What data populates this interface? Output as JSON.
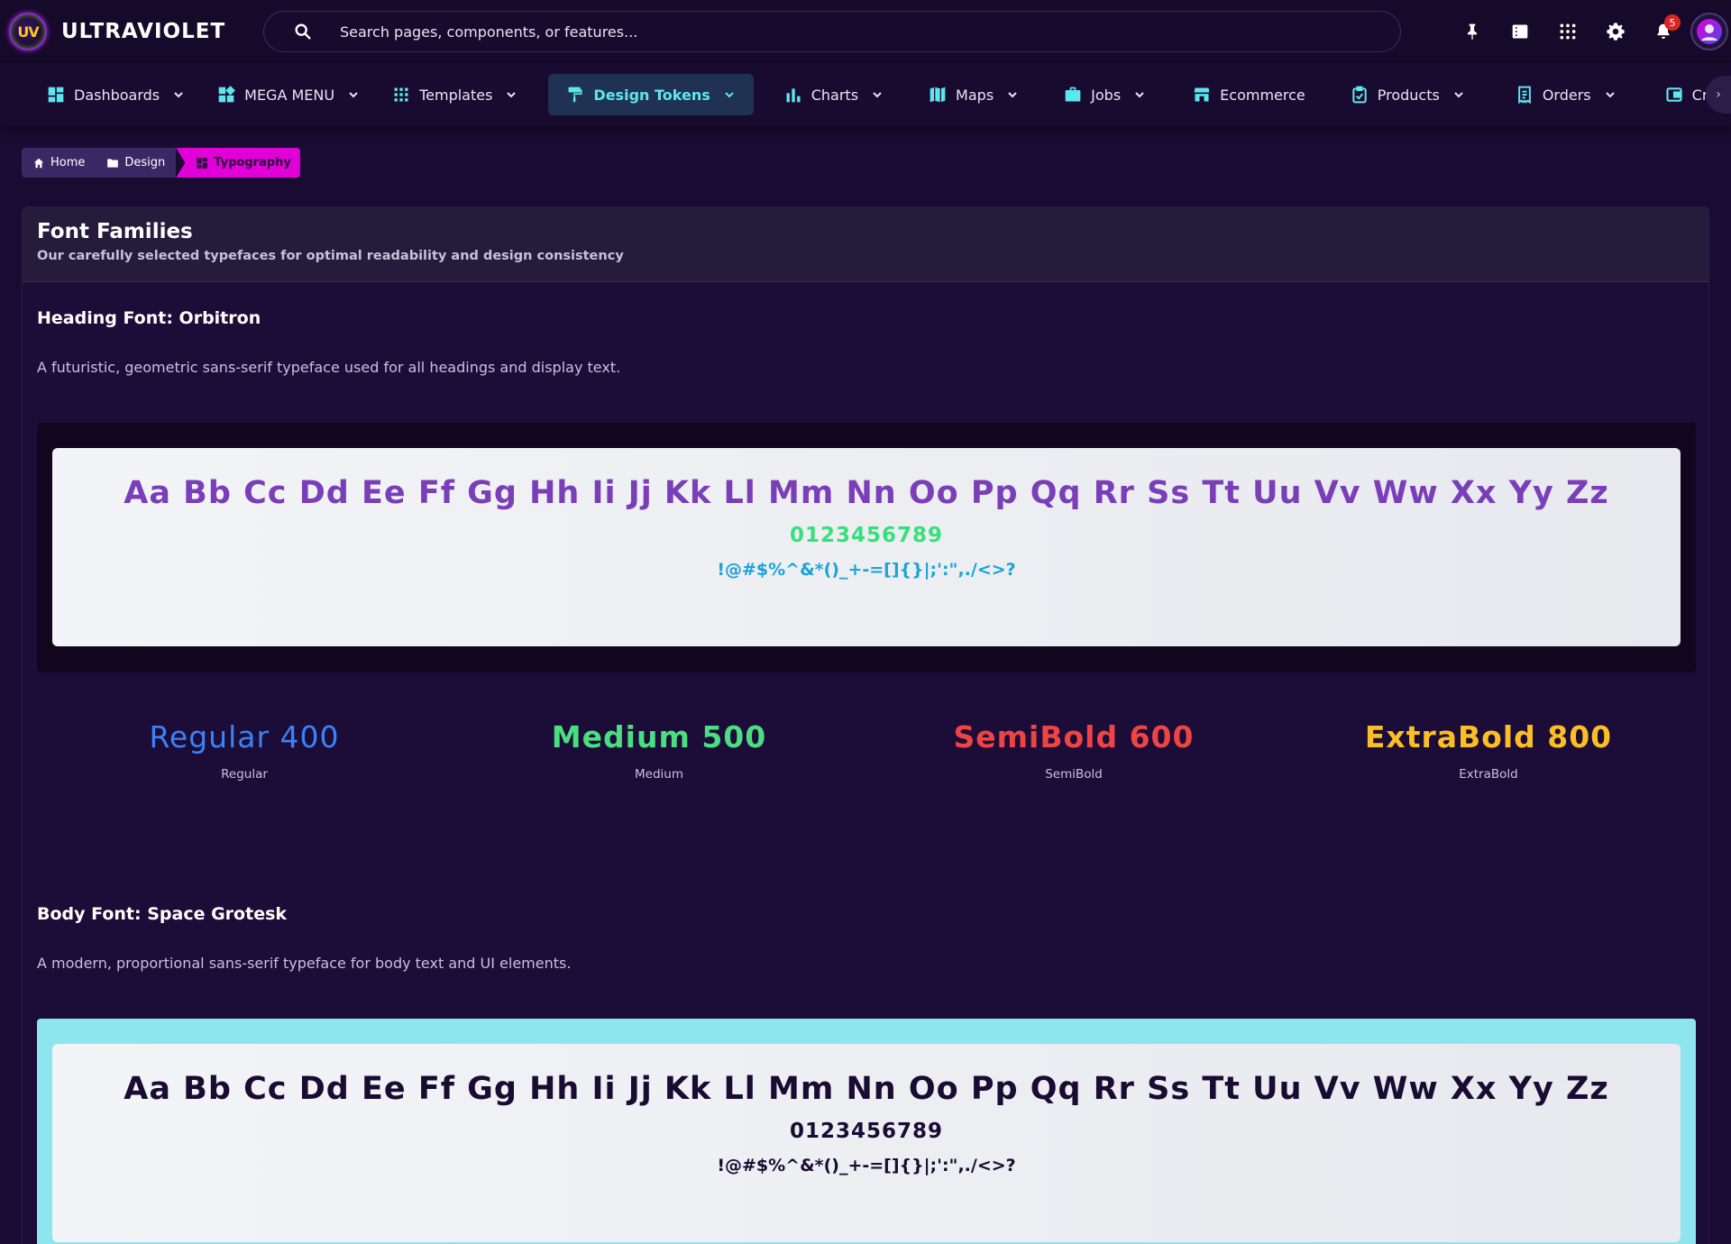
{
  "app": {
    "logo_badge": "UV",
    "name": "ULTRAVIOLET"
  },
  "search": {
    "placeholder": "Search pages, components, or features..."
  },
  "header_actions": {
    "notification_count": "5"
  },
  "nav": {
    "items": [
      {
        "label": "Dashboards",
        "icon": "dashboard-icon",
        "dropdown": true
      },
      {
        "label": "MEGA MENU",
        "icon": "mega-menu-icon",
        "dropdown": true
      },
      {
        "label": "Templates",
        "icon": "grid-dots-icon",
        "dropdown": true
      },
      {
        "label": "Design Tokens",
        "icon": "paint-roller-icon",
        "dropdown": true,
        "active": true
      },
      {
        "label": "Charts",
        "icon": "bar-chart-icon",
        "dropdown": true
      },
      {
        "label": "Maps",
        "icon": "map-icon",
        "dropdown": true
      },
      {
        "label": "Jobs",
        "icon": "briefcase-icon",
        "dropdown": true
      },
      {
        "label": "Ecommerce",
        "icon": "store-icon",
        "dropdown": false
      },
      {
        "label": "Products",
        "icon": "clipboard-icon",
        "dropdown": true
      },
      {
        "label": "Orders",
        "icon": "receipt-icon",
        "dropdown": true
      },
      {
        "label": "Cr",
        "icon": "wallet-icon",
        "dropdown": false
      }
    ]
  },
  "breadcrumb": {
    "items": [
      {
        "label": "Home",
        "icon": "home-icon"
      },
      {
        "label": "Design",
        "icon": "folder-icon"
      },
      {
        "label": "Typography",
        "icon": "dashboard-icon"
      }
    ]
  },
  "card": {
    "title": "Font Families",
    "subtitle": "Our carefully selected typefaces for optimal readability and design consistency"
  },
  "heading_font": {
    "title": "Heading Font: Orbitron",
    "description": "A futuristic, geometric sans-serif typeface used for all headings and display text.",
    "sample_letters": "Aa Bb Cc Dd Ee Ff Gg Hh Ii Jj Kk Ll Mm Nn Oo Pp Qq Rr Ss Tt Uu Vv Ww Xx Yy Zz",
    "sample_digits": "0123456789",
    "sample_symbols": "!@#$%^&*()_+-=[]{}|;':\",./<>?",
    "weights": [
      {
        "name": "Regular 400",
        "label": "Regular",
        "color": "#3b82f6",
        "weight": "400"
      },
      {
        "name": "Medium 500",
        "label": "Medium",
        "color": "#4ade80",
        "weight": "500"
      },
      {
        "name": "SemiBold 600",
        "label": "SemiBold",
        "color": "#ef4444",
        "weight": "600"
      },
      {
        "name": "ExtraBold 800",
        "label": "ExtraBold",
        "color": "#fbbf24",
        "weight": "800"
      }
    ]
  },
  "body_font": {
    "title": "Body Font: Space Grotesk",
    "description": "A modern, proportional sans-serif typeface for body text and UI elements.",
    "sample_letters": "Aa Bb Cc Dd Ee Ff Gg Hh Ii Jj Kk Ll Mm Nn Oo Pp Qq Rr Ss Tt Uu Vv Ww Xx Yy Zz",
    "sample_digits": "0123456789",
    "sample_symbols": "!@#$%^&*()_+-=[]{}|;':\",./<>?"
  },
  "colors": {
    "accent_cyan": "#5ee6ee",
    "breadcrumb_current": "#e100d8",
    "heading_letters": "#7a3fb8",
    "heading_digits": "#36e07a",
    "heading_symbols": "#1aa3d9"
  }
}
